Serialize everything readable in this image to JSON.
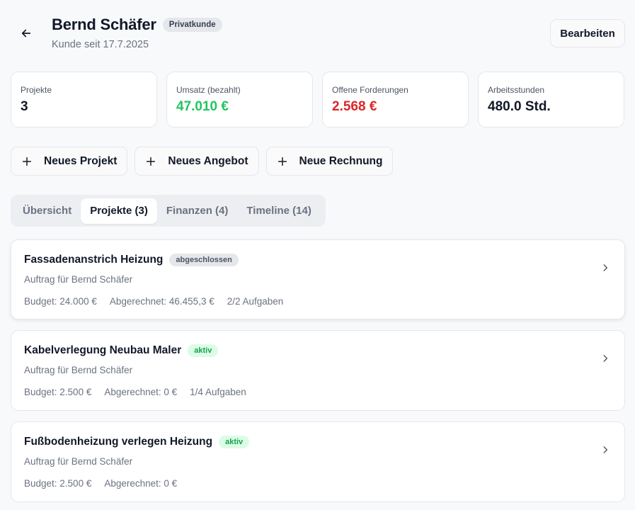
{
  "header": {
    "title": "Bernd Schäfer",
    "badge": "Privatkunde",
    "subtitle": "Kunde seit 17.7.2025",
    "edit_label": "Bearbeiten"
  },
  "stats": [
    {
      "label": "Projekte",
      "value": "3"
    },
    {
      "label": "Umsatz (bezahlt)",
      "value": "47.010 €"
    },
    {
      "label": "Offene Forderungen",
      "value": "2.568 €"
    },
    {
      "label": "Arbeitsstunden",
      "value": "480.0 Std."
    }
  ],
  "actions": [
    {
      "label": "Neues Projekt"
    },
    {
      "label": "Neues Angebot"
    },
    {
      "label": "Neue Rechnung"
    }
  ],
  "tabs": [
    {
      "label": "Übersicht"
    },
    {
      "label": "Projekte (3)"
    },
    {
      "label": "Finanzen (4)"
    },
    {
      "label": "Timeline (14)"
    }
  ],
  "projects": [
    {
      "title": "Fassadenanstrich Heizung",
      "status": "abgeschlossen",
      "subtitle": "Auftrag für Bernd Schäfer",
      "budget": "Budget: 24.000 €",
      "billed": "Abgerechnet: 46.455,3 €",
      "tasks": "2/2 Aufgaben"
    },
    {
      "title": "Kabelverlegung Neubau Maler",
      "status": "aktiv",
      "subtitle": "Auftrag für Bernd Schäfer",
      "budget": "Budget: 2.500 €",
      "billed": "Abgerechnet: 0 €",
      "tasks": "1/4 Aufgaben"
    },
    {
      "title": "Fußbodenheizung verlegen Heizung",
      "status": "aktiv",
      "subtitle": "Auftrag für Bernd Schäfer",
      "budget": "Budget: 2.500 €",
      "billed": "Abgerechnet: 0 €"
    }
  ],
  "icons": {
    "back": "arrow-left-icon",
    "plus": "plus-icon",
    "chevron": "chevron-right-icon"
  },
  "colors": {
    "positive": "#22c55e",
    "negative": "#dc2626",
    "active_badge_bg": "#dcfce7",
    "active_badge_text": "#16a34a"
  }
}
